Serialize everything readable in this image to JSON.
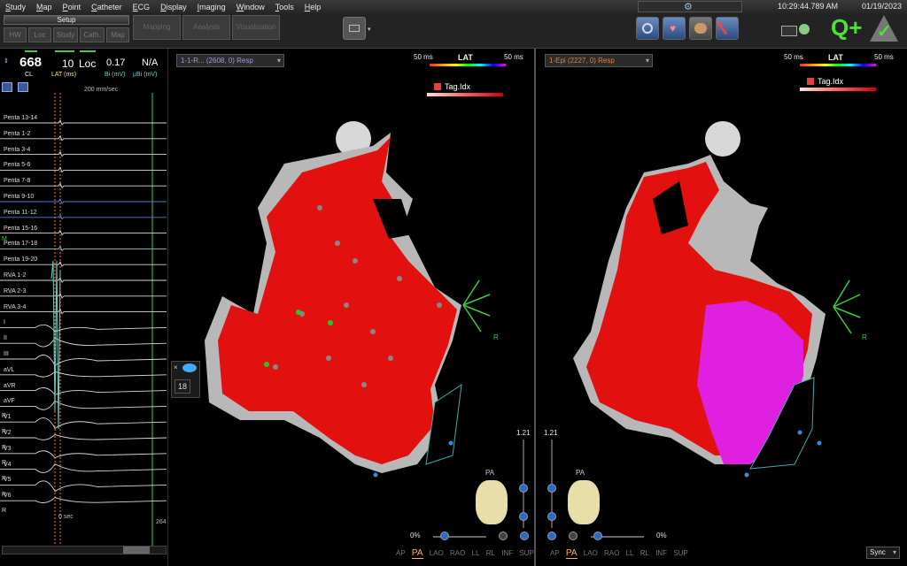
{
  "menu": [
    "Study",
    "Map",
    "Point",
    "Catheter",
    "ECG",
    "Display",
    "Imaging",
    "Window",
    "Tools",
    "Help"
  ],
  "status": {
    "time": "10:29:44.789 AM",
    "date": "01/19/2023"
  },
  "toolbar": {
    "setup_label": "Setup",
    "setup_buttons": [
      "HW",
      "Loc",
      "Study",
      "Cath.",
      "Map"
    ],
    "big_buttons": [
      "Mapping",
      "Analysis",
      "Visualization"
    ]
  },
  "left_panel": {
    "cl_value": "668",
    "cl_label": "CL",
    "lat_value": "10",
    "lat_label": "LAT (ms)",
    "loc_label": "Loc",
    "bi_value": "0.17",
    "bi_label": "Bi (mV)",
    "ubi_value": "N/A",
    "ubi_label": "µBi (mV)",
    "speed": "200 mm/sec",
    "zero_sec": "0 sec",
    "count": "264",
    "channels": [
      "Penta 13-14",
      "Penta 1-2",
      "Penta 3-4",
      "Penta 5-6",
      "Penta 7-8",
      "Penta 9-10",
      "Penta 11-12",
      "Penta 15-16",
      "Penta 17-18",
      "Penta 19-20",
      "RVA 1-2",
      "RVA 2-3",
      "RVA 3-4",
      "I",
      "II",
      "III",
      "aVL",
      "aVR",
      "aVF",
      "V1",
      "V2",
      "V3",
      "V4",
      "V5",
      "V6"
    ],
    "r_marks": [
      "R",
      "R",
      "R",
      "R",
      "R",
      "R",
      "R"
    ],
    "m_mark": "M"
  },
  "pane1": {
    "dropdown": "1-1-R... (2608, 0) Resp",
    "scale_min": "50 ms",
    "scale_title": "LAT",
    "scale_max": "50 ms",
    "tag_title": "Tag.Idx",
    "zoom_value": "1.21",
    "view_label": "PA",
    "pct": "0%",
    "orient_label": "R",
    "side_number": "18",
    "views": [
      "AP",
      "PA",
      "LAO",
      "RAO",
      "LL",
      "RL",
      "INF",
      "SUP"
    ],
    "active_view": "PA"
  },
  "pane2": {
    "dropdown": "1-Epi (2227, 0) Resp",
    "scale_min": "50 ms",
    "scale_title": "LAT",
    "scale_max": "50 ms",
    "tag_title": "Tag.Idx",
    "zoom_value": "1.21",
    "view_label": "PA",
    "pct": "0%",
    "orient_label": "R",
    "views": [
      "AP",
      "PA",
      "LAO",
      "RAO",
      "LL",
      "RL",
      "INF",
      "SUP"
    ],
    "active_view": "PA"
  },
  "sync": "Sync",
  "colors": {
    "map_red": "#e31010",
    "map_grey": "#b8b8b8",
    "map_magenta": "#e020e0",
    "bg": "#000000"
  }
}
